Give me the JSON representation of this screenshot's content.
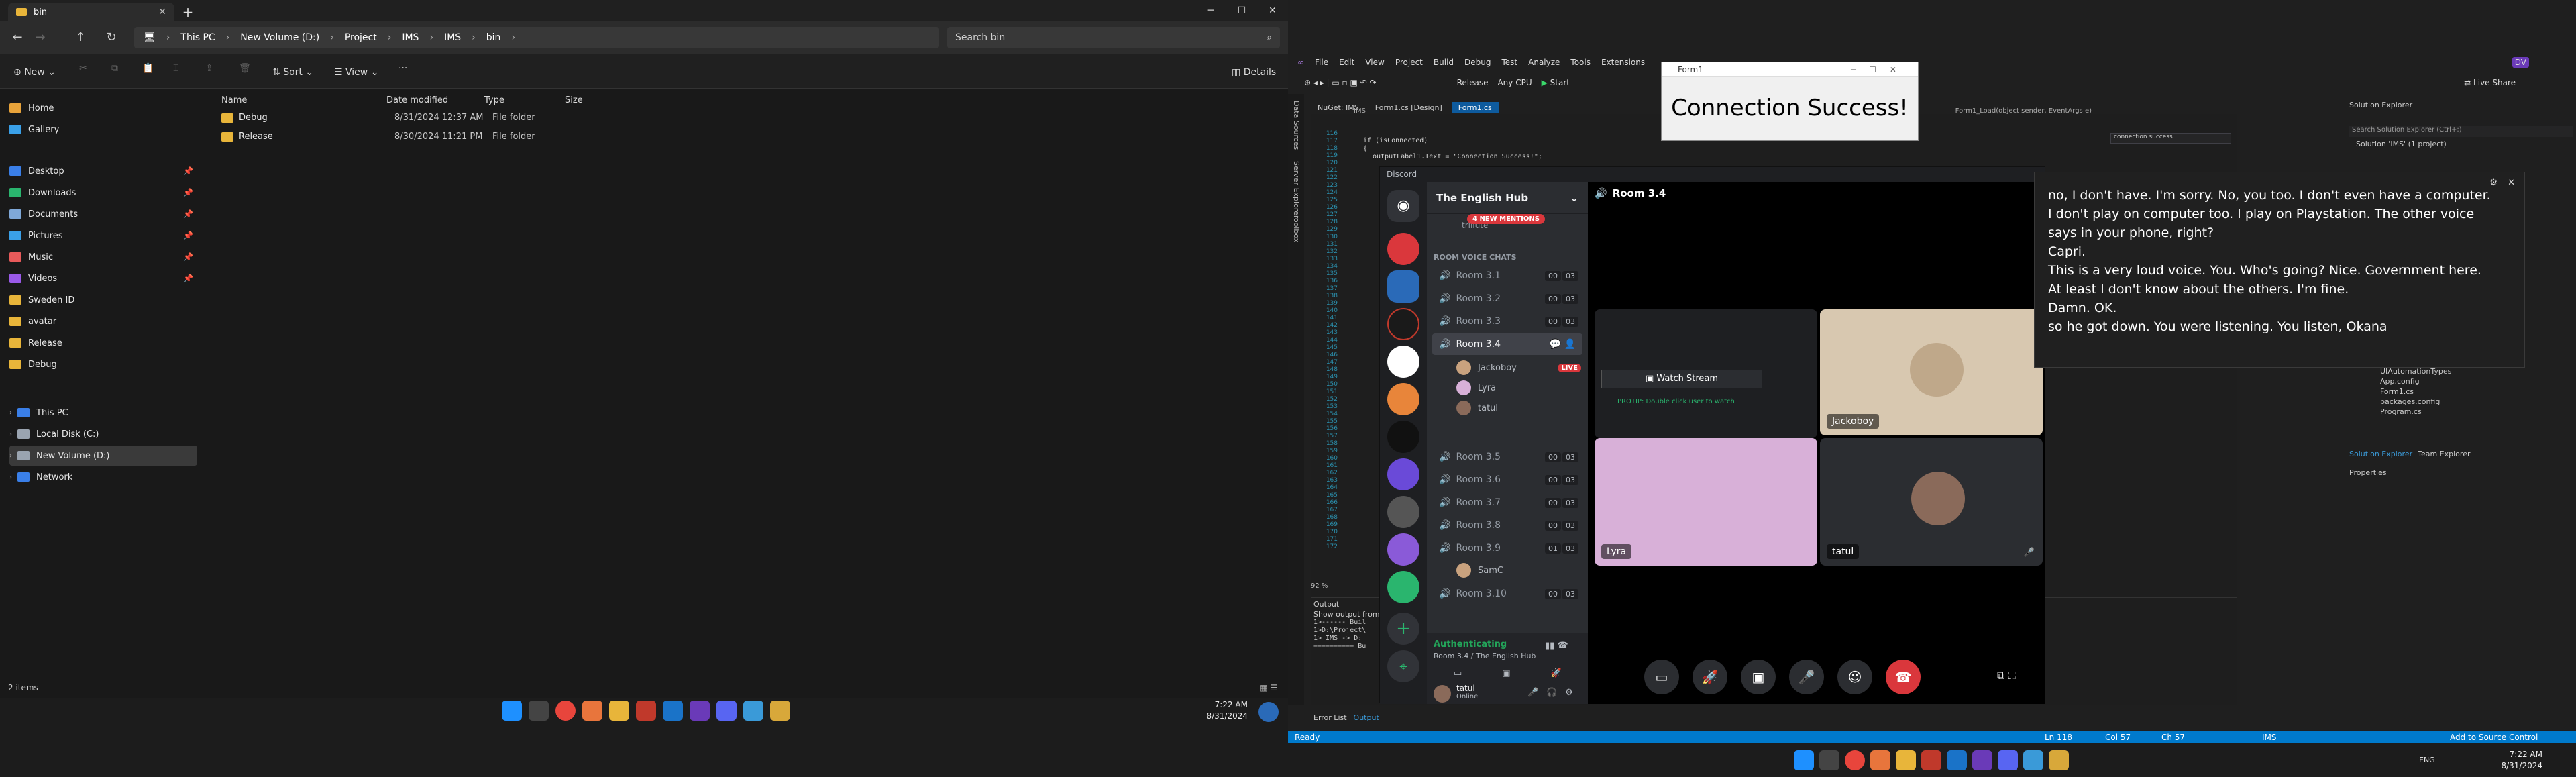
{
  "explorer": {
    "tab_title": "bin",
    "breadcrumb": [
      "This PC",
      "New Volume (D:)",
      "Project",
      "IMS",
      "IMS",
      "bin"
    ],
    "search_placeholder": "Search bin",
    "toolbar": {
      "new": "New",
      "sort": "Sort",
      "view": "View",
      "more": "···",
      "details": "Details"
    },
    "sidebar": {
      "quick": [
        {
          "label": "Home",
          "icon": "home-icon",
          "color": "#e8a33a"
        },
        {
          "label": "Gallery",
          "icon": "gallery-icon",
          "color": "#3aa0e8"
        },
        {
          "label": "Desktop",
          "icon": "desktop-icon",
          "color": "#3a7fe8",
          "pinned": true
        },
        {
          "label": "Downloads",
          "icon": "download-icon",
          "color": "#2ab56e",
          "pinned": true
        },
        {
          "label": "Documents",
          "icon": "documents-icon",
          "color": "#7fa8d8",
          "pinned": true
        },
        {
          "label": "Pictures",
          "icon": "pictures-icon",
          "color": "#3aa0e8",
          "pinned": true
        },
        {
          "label": "Music",
          "icon": "music-icon",
          "color": "#e85a5a",
          "pinned": true
        },
        {
          "label": "Videos",
          "icon": "videos-icon",
          "color": "#9a5ae8",
          "pinned": true
        },
        {
          "label": "Sweden ID",
          "icon": "folder-icon",
          "color": "#e8b53a"
        },
        {
          "label": "avatar",
          "icon": "folder-icon",
          "color": "#e8b53a"
        },
        {
          "label": "Release",
          "icon": "folder-icon",
          "color": "#e8b53a"
        },
        {
          "label": "Debug",
          "icon": "folder-icon",
          "color": "#e8b53a"
        }
      ],
      "tree": [
        {
          "label": "This PC",
          "icon": "pc-icon",
          "color": "#3a7fe8"
        },
        {
          "label": "Local Disk (C:)",
          "icon": "drive-icon",
          "color": "#9aa4b0"
        },
        {
          "label": "New Volume (D:)",
          "icon": "drive-icon",
          "color": "#9aa4b0",
          "selected": true
        },
        {
          "label": "Network",
          "icon": "network-icon",
          "color": "#3a7fe8"
        }
      ]
    },
    "columns": {
      "name": "Name",
      "date": "Date modified",
      "type": "Type",
      "size": "Size"
    },
    "files": [
      {
        "name": "Debug",
        "date": "8/31/2024 12:37 AM",
        "type": "File folder"
      },
      {
        "name": "Release",
        "date": "8/30/2024 11:21 PM",
        "type": "File folder"
      }
    ],
    "status": "2 items",
    "clock": {
      "time": "7:22 AM",
      "date": "8/31/2024"
    }
  },
  "vs": {
    "menu": [
      "File",
      "Edit",
      "View",
      "Project",
      "Build",
      "Debug",
      "Test",
      "Analyze",
      "Tools",
      "Extensions"
    ],
    "config": "Release",
    "platform": "Any CPU",
    "start": "Start",
    "live_share": "Live Share",
    "tabs": [
      "NuGet: IMS",
      "Form1.cs [Design]",
      "Form1.cs"
    ],
    "code": [
      "if (isConnected)",
      "{",
      "outputLabel1.Text = \"Connection Success!\";"
    ],
    "output_label": "Output",
    "output_source": "Show output from:",
    "output_lines": [
      "1>------ Buil",
      "1>D:\\Project\\",
      "1>  IMS -> D:",
      "========== Bu"
    ],
    "bottom_tabs": [
      "Error List",
      "Output"
    ],
    "zoom": "92 %",
    "solution_explorer": "Solution Explorer",
    "solution_search": "Search Solution Explorer (Ctrl+;)",
    "solution_root": "Solution 'IMS' (1 project)",
    "solution_items": [
      "UIAutomationTypes",
      "App.config",
      "Form1.cs",
      "packages.config",
      "Program.cs"
    ],
    "panel_tabs": [
      "Solution Explorer",
      "Team Explorer"
    ],
    "properties": "Properties",
    "status": {
      "ready": "Ready",
      "line": "Ln 118",
      "col": "Col 57",
      "ch": "Ch 57",
      "project": "IMS",
      "source": "Add to Source Control"
    },
    "search_doc": "connection success",
    "nav_member": "Form1_Load(object sender, EventArgs e)",
    "clock": {
      "time": "7:22 AM",
      "date": "8/31/2024"
    },
    "lang": "ENG"
  },
  "form1": {
    "title": "Form1",
    "message": "Connection Success!"
  },
  "discord": {
    "app": "Discord",
    "server": "The English Hub",
    "mentions": "4 NEW MENTIONS",
    "category": "ROOM VOICE CHATS",
    "other_user": "trillute",
    "rooms": [
      {
        "name": "Room 3.1",
        "count": "00",
        "limit": "03"
      },
      {
        "name": "Room 3.2",
        "count": "00",
        "limit": "03"
      },
      {
        "name": "Room 3.3",
        "count": "00",
        "limit": "03"
      },
      {
        "name": "Room 3.4",
        "count": "",
        "limit": ""
      },
      {
        "name": "Room 3.5",
        "count": "00",
        "limit": "03"
      },
      {
        "name": "Room 3.6",
        "count": "00",
        "limit": "03"
      },
      {
        "name": "Room 3.7",
        "count": "00",
        "limit": "03"
      },
      {
        "name": "Room 3.8",
        "count": "00",
        "limit": "03"
      },
      {
        "name": "Room 3.9",
        "count": "01",
        "limit": "03"
      },
      {
        "name": "Room 3.10",
        "count": "00",
        "limit": "03"
      }
    ],
    "room_users": [
      {
        "name": "Jackoboy",
        "live": "LIVE",
        "color": "#c9a27e"
      },
      {
        "name": "Lyra",
        "color": "#d8b0d8"
      },
      {
        "name": "tatul",
        "color": "#8a6a5a"
      }
    ],
    "room39_user": "SamC",
    "stage_title": "Room 3.4",
    "voice_status": "Authenticating",
    "voice_channel": "Room 3.4 / The English Hub",
    "user": {
      "name": "tatul",
      "status": "Online"
    },
    "watch_stream": "Watch Stream",
    "protip": "PROTIP: Double click user to watch",
    "tiles": [
      "Jackoboy",
      "Lyra",
      "tatul"
    ]
  },
  "captions": {
    "lines": [
      "no, I don't have. I'm sorry. No, you too. I don't even have a computer.",
      "I don't play on computer too. I play on Playstation. The other voice says in your phone, right?",
      "Capri.",
      "This is a very loud voice. You. Who's going? Nice. Government here.",
      "At least I don't know about the others. I'm fine.",
      "Damn. OK.",
      "so he got down. You were listening. You listen, Okana"
    ]
  }
}
